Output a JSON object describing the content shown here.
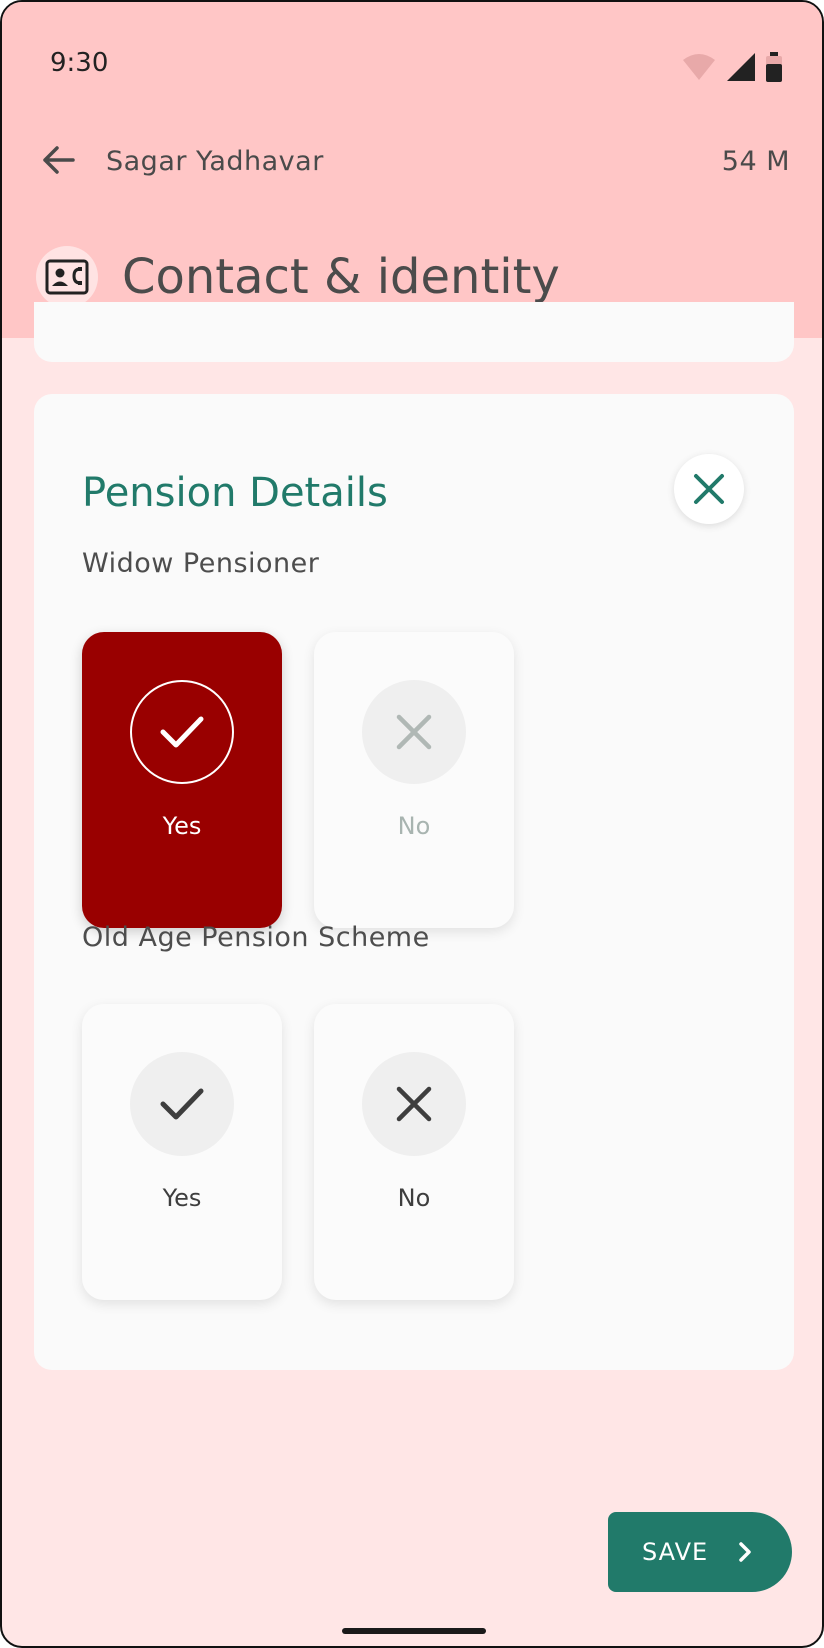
{
  "status_bar": {
    "time": "9:30"
  },
  "header": {
    "patient_name": "Sagar Yadhavar",
    "patient_meta": "54 M",
    "section_title": "Contact & identity"
  },
  "card": {
    "title": "Pension Details",
    "questions": [
      {
        "label": "Widow Pensioner",
        "selected": "Yes",
        "options": [
          {
            "label": "Yes"
          },
          {
            "label": "No"
          }
        ]
      },
      {
        "label": "Old Age Pension Scheme",
        "selected": null,
        "options": [
          {
            "label": "Yes"
          },
          {
            "label": "No"
          }
        ]
      }
    ]
  },
  "footer": {
    "save_label": "SAVE"
  },
  "colors": {
    "header_bg": "#ffc6c6",
    "page_bg": "#ffe6e6",
    "accent": "#217a6a",
    "selected": "#990000"
  }
}
